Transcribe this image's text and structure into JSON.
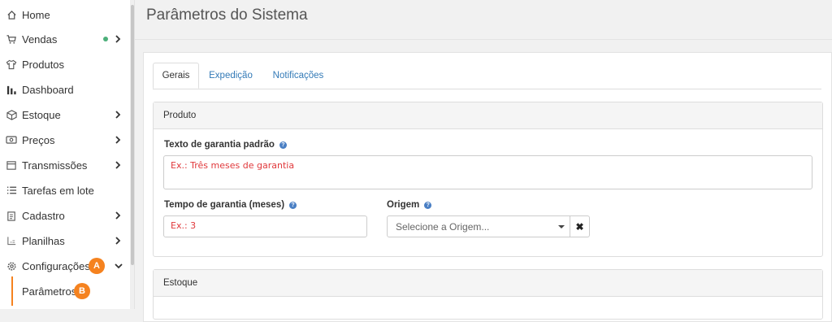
{
  "sidebar": {
    "items": [
      {
        "label": "Home",
        "icon": "home-icon"
      },
      {
        "label": "Vendas",
        "icon": "cart-icon"
      },
      {
        "label": "Produtos",
        "icon": "shirt-icon"
      },
      {
        "label": "Dashboard",
        "icon": "bar-chart-icon"
      },
      {
        "label": "Estoque",
        "icon": "box-icon"
      },
      {
        "label": "Preços",
        "icon": "price-tag-icon"
      },
      {
        "label": "Transmissões",
        "icon": "store-icon"
      },
      {
        "label": "Tarefas em lote",
        "icon": "list-icon"
      },
      {
        "label": "Cadastro",
        "icon": "clipboard-icon"
      },
      {
        "label": "Planilhas",
        "icon": "spreadsheet-icon"
      },
      {
        "label": "Configurações",
        "icon": "gear-icon"
      }
    ],
    "sub_item": {
      "label": "Parâmetros"
    },
    "badges": {
      "a": "A",
      "b": "B"
    }
  },
  "header": {
    "title": "Parâmetros do Sistema"
  },
  "tabs": [
    {
      "label": "Gerais"
    },
    {
      "label": "Expedição"
    },
    {
      "label": "Notificações"
    }
  ],
  "panels": {
    "produto": {
      "title": "Produto",
      "warranty_text": {
        "label": "Texto de garantia padrão",
        "placeholder": "Ex.: Três meses de garantia"
      },
      "warranty_time": {
        "label": "Tempo de garantia (meses)",
        "placeholder": "Ex.: 3"
      },
      "origin": {
        "label": "Origem",
        "placeholder": "Selecione a Origem...",
        "clear": "✖"
      }
    },
    "estoque": {
      "title": "Estoque"
    }
  },
  "colors": {
    "badge": "#f5821f",
    "status_dot": "#4caf7a",
    "link": "#337ab7",
    "placeholder": "#e0383b"
  }
}
